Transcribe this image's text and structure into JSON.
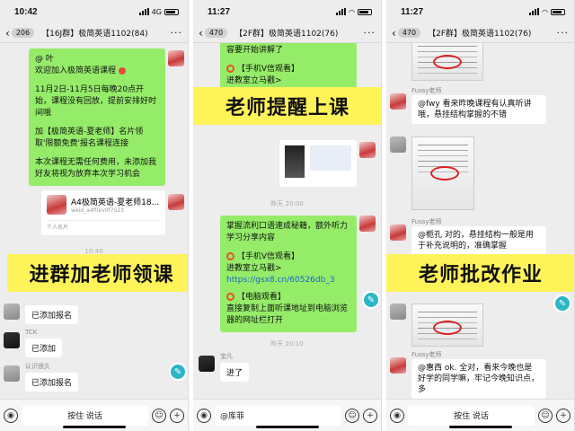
{
  "phones": [
    {
      "time": "10:42",
      "network": "4G",
      "badge": "206",
      "title": "【16J群】极简英语1102(84)",
      "messages": {
        "m1_line1": "@ 叶",
        "m1_line2": "欢迎加入极简英语课程",
        "m1_line3": "11月2日-11月5日每晚20点开始，课程没有回放，提前安排好时间哦",
        "m1_line4": "加【极简英语-夏老师】名片领取'限额免费'报名课程连接",
        "m1_line5": "本次课程无需任何费用，未添加我好友将视为放弃本次学习机会",
        "card_title": "A4极简英语-夏老师18...",
        "card_sub": "weid_a4f0ev0f7523",
        "card_foot": "个人名片",
        "ts1": "10:40",
        "r1": "已添加报名",
        "user2": "TCK",
        "r2": "已添加",
        "user3": "认识很久",
        "r3": "已添加报名"
      },
      "bottom_label": "按住 说话",
      "banner": "进群加老师领课"
    },
    {
      "time": "11:27",
      "badge": "470",
      "title": "【2F群】极简英语1102(76)",
      "messages": {
        "top": "容要开始讲解了",
        "v1": "【手机V信观看】",
        "v2": "进教室立马戳>",
        "ts1": "昨天 20:00",
        "b1": "掌握流利口语速成秘籍，额外听力学习分享内容",
        "b2": "【手机V信观看】",
        "b3": "进教室立马戳>",
        "b4": "https://gsx8.cn/60526db_3",
        "b5": "【电脑观看】",
        "b6": "直接复制上面听课地址到电脑浏览器的网址栏打开",
        "ts2": "昨天 20:10",
        "user": "宝凡",
        "r1": "进了"
      },
      "input_text": "@库菲",
      "banner": "老师提醒上课"
    },
    {
      "time": "11:27",
      "badge": "470",
      "title": "【2F群】极简英语1102(76)",
      "messages": {
        "user1": "Fussy老师",
        "t1": "@fwy 看来昨晚课程有认真听讲哦，悬挂结构掌握的不错",
        "user2": "Fussy老师",
        "t2": "@栀孔 对的，悬挂结构一般是用于补充说明的，准确掌握",
        "user3": "Fussy老师",
        "t3": "@惠西 ok. 全对，看来今晚也是好学的同学嘛，牢记今晚知识点，多"
      },
      "bottom_label": "按住 说话",
      "banner": "老师批改作业"
    }
  ]
}
